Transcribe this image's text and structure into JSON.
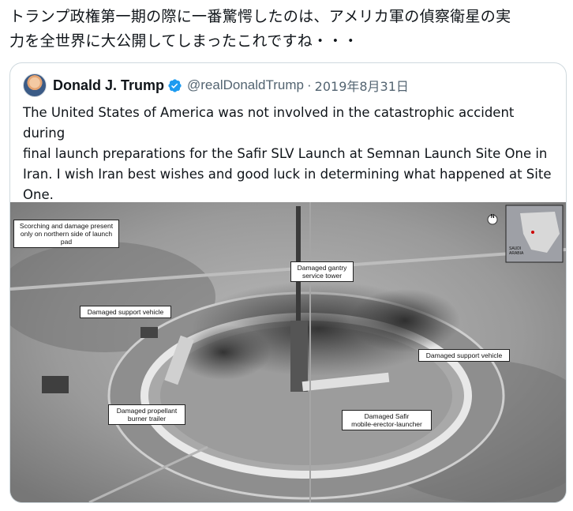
{
  "tweet": {
    "text_line1": "トランプ政権第一期の際に一番驚愕したのは、アメリカ軍の偵察衛星の実",
    "text_line2": "力を全世界に大公開してしまったこれですね・・・"
  },
  "quoted_tweet": {
    "display_name": "Donald J. Trump",
    "handle": "@realDonaldTrump",
    "separator": "·",
    "date": "2019年8月31日",
    "body": "The United States of America was not involved in the catastrophic accident during final launch preparations for the Safir SLV Launch at Semnan Launch Site One in Iran. I wish Iran best wishes and good luck in determining what happened at Site One.",
    "body_lines": [
      "The United States of America was not involved in the catastrophic accident during",
      "final launch preparations for the Safir SLV Launch at Semnan Launch Site One in",
      "Iran. I wish Iran best wishes and good luck in determining what happened at Site",
      "One."
    ],
    "icons": {
      "avatar": "avatar",
      "verified": "verified-badge-icon"
    },
    "colors": {
      "verified": "#1d9bf0",
      "secondary_text": "#536471"
    }
  },
  "image": {
    "callouts": {
      "scorching": "Scorching and damage present\nonly on northern side of launch pad",
      "gantry": "Damaged gantry\nservice tower",
      "support_left": "Damaged support vehicle",
      "support_right": "Damaged support vehicle",
      "propellant": "Damaged propellant\nburner trailer",
      "safir": "Damaged Safir\nmobile-erector-launcher"
    },
    "inset_map": {
      "north": "N",
      "saudi": "SAUDI\nARABIA"
    }
  }
}
